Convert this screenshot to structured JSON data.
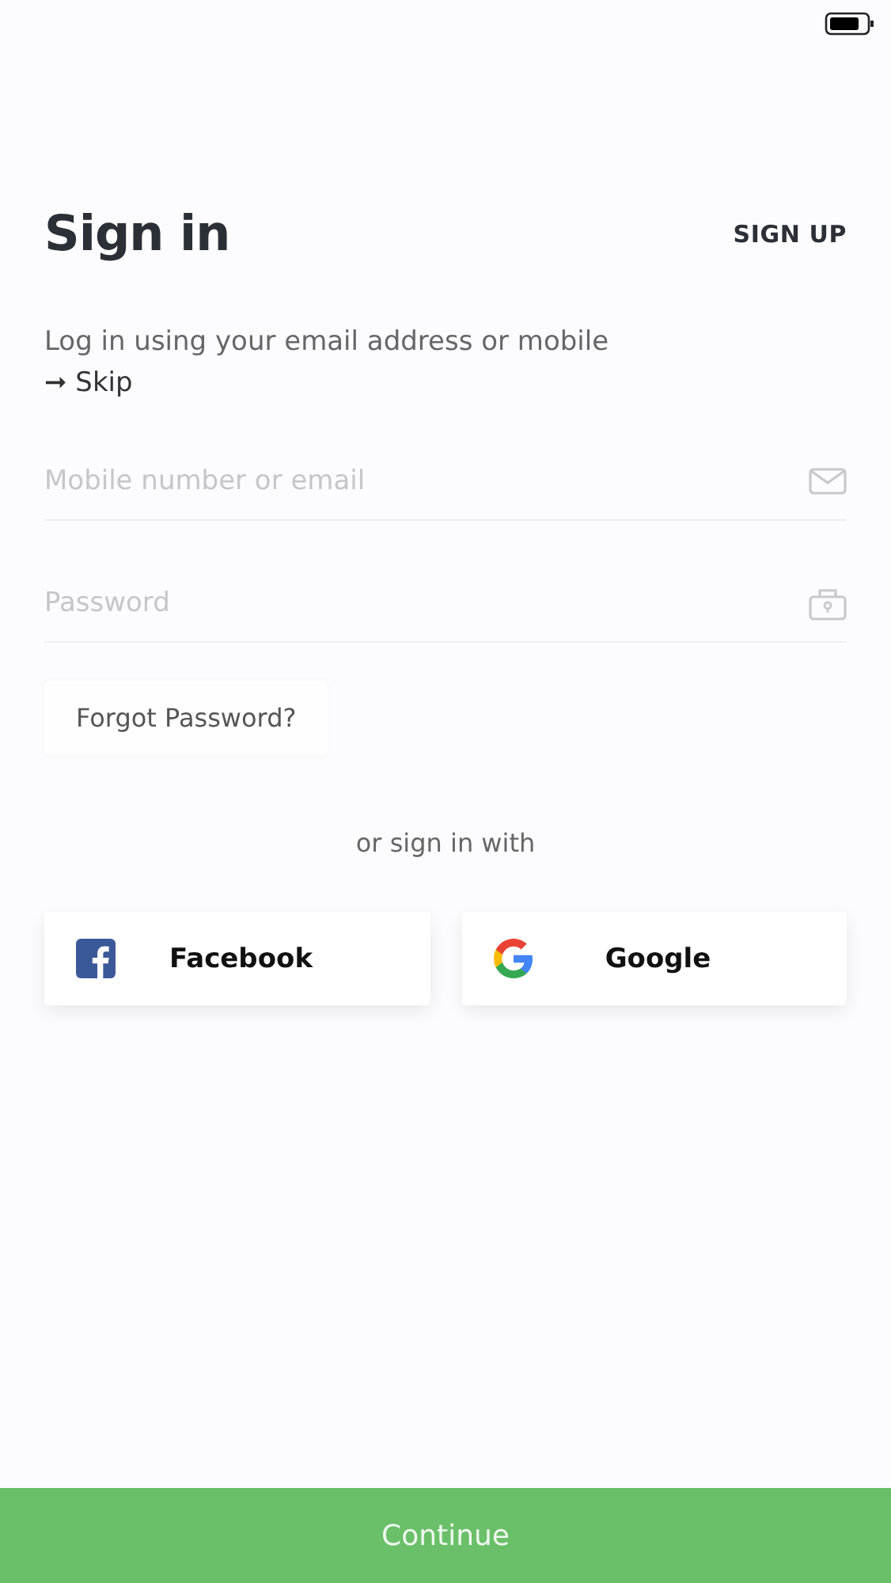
{
  "title": "Sign in",
  "sign_up": "SIGN UP",
  "subtitle": "Log in using your email address or mobile",
  "skip": "➞ Skip",
  "fields": [
    {
      "kind": "email",
      "placeholder": "Mobile number or email"
    },
    {
      "kind": "password",
      "placeholder": "Password"
    }
  ],
  "forgot_password": "Forgot Password?",
  "divider_text": "or sign in with",
  "social": [
    {
      "kind": "facebook",
      "label": "Facebook"
    },
    {
      "kind": "google",
      "label": "Google"
    }
  ],
  "continue": "Continue"
}
